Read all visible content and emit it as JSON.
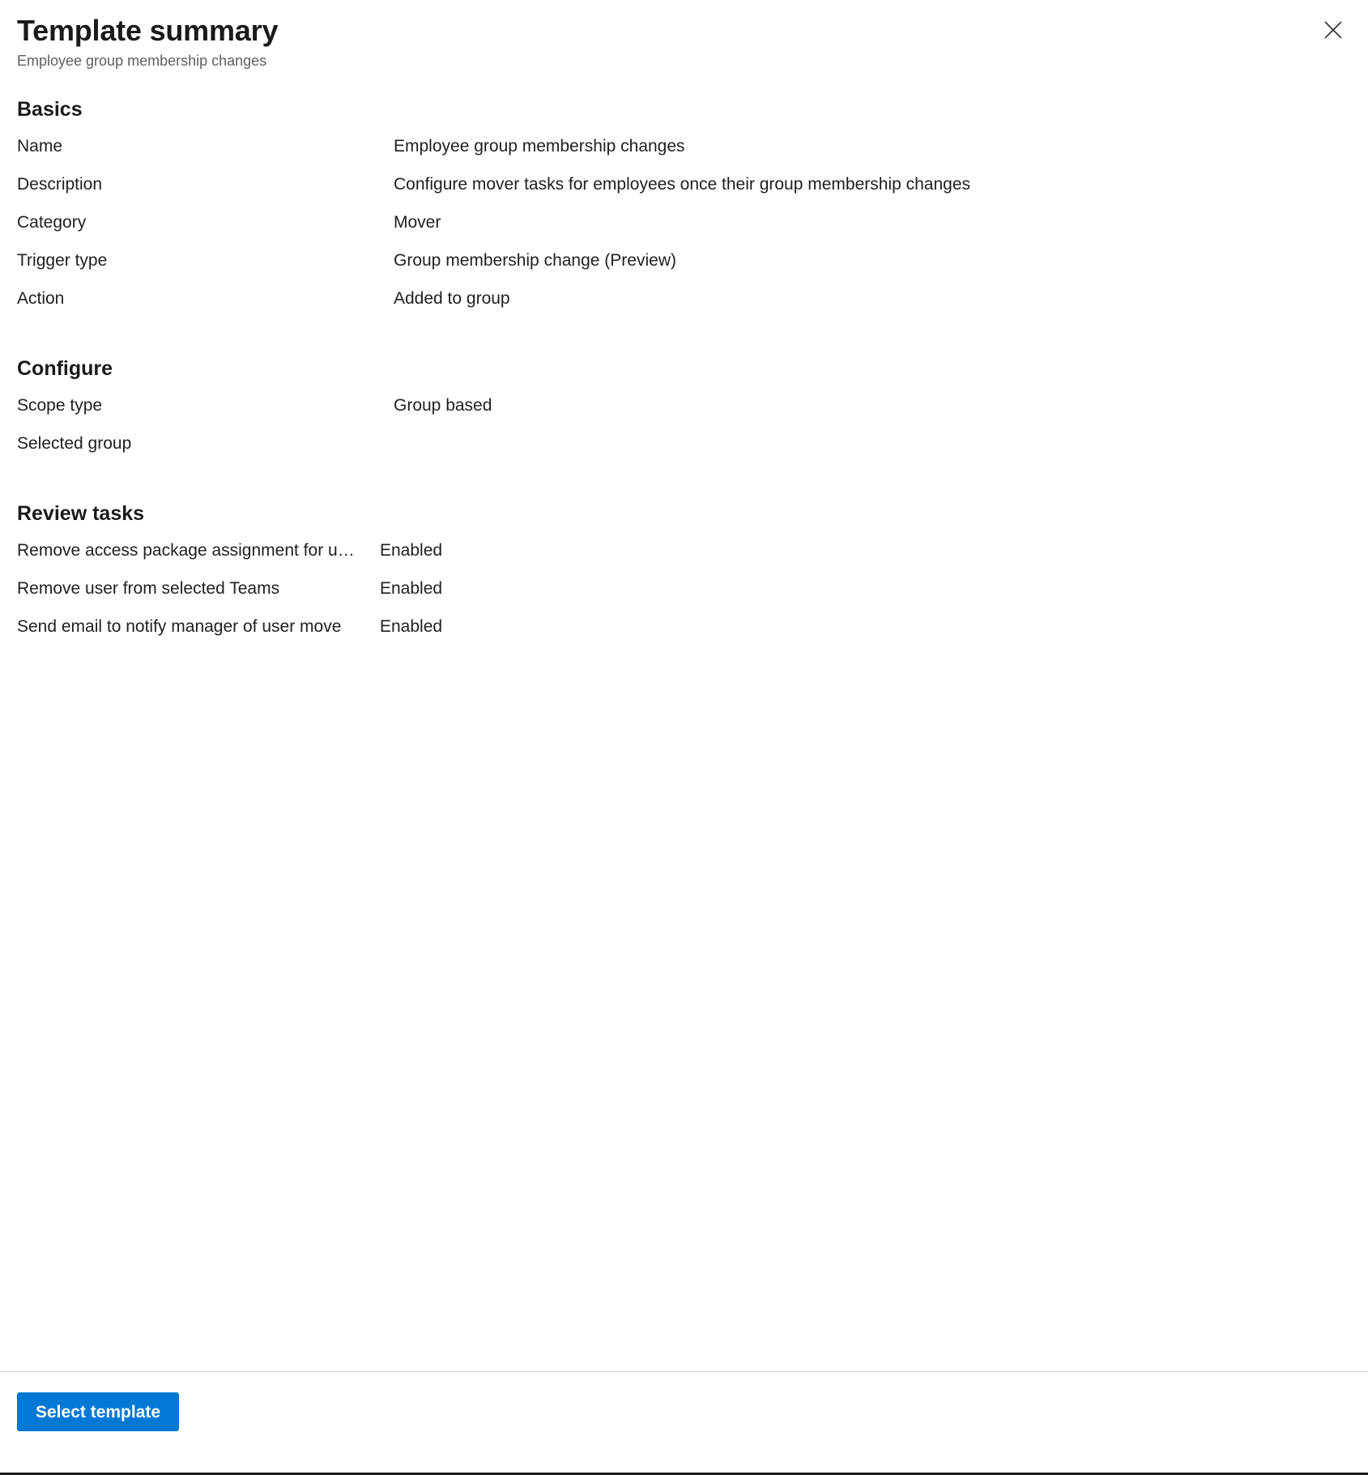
{
  "header": {
    "title": "Template summary",
    "subtitle": "Employee group membership changes",
    "close_icon": "close-icon"
  },
  "sections": [
    {
      "id": "basics",
      "heading": "Basics",
      "rows": [
        {
          "label": "Name",
          "value": "Employee group membership changes"
        },
        {
          "label": "Description",
          "value": "Configure mover tasks for employees once their group membership changes"
        },
        {
          "label": "Category",
          "value": "Mover"
        },
        {
          "label": "Trigger type",
          "value": "Group membership change (Preview)"
        },
        {
          "label": "Action",
          "value": "Added to group"
        }
      ]
    },
    {
      "id": "configure",
      "heading": "Configure",
      "rows": [
        {
          "label": "Scope type",
          "value": "Group based"
        },
        {
          "label": "Selected group",
          "value": ""
        }
      ]
    },
    {
      "id": "review-tasks",
      "heading": "Review tasks",
      "rows": [
        {
          "label": "Remove access package assignment for u…",
          "value": "Enabled"
        },
        {
          "label": "Remove user from selected Teams",
          "value": "Enabled"
        },
        {
          "label": "Send email to notify manager of user move",
          "value": "Enabled"
        }
      ]
    }
  ],
  "footer": {
    "select_template_label": "Select template"
  },
  "colors": {
    "accent": "#0078d4",
    "text": "#201f1e",
    "subtle_text": "#605e5c",
    "divider": "#d2d0ce"
  }
}
